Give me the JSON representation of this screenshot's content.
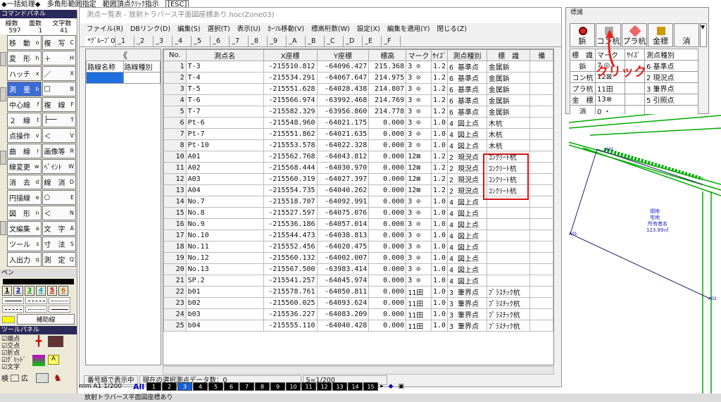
{
  "topbar": {
    "items": [
      "◆一括処理◆",
      "多角形範囲指定",
      "範囲頂点ｸﾘｯｸ指示",
      "[ESC]"
    ]
  },
  "left_panel": {
    "title": "コマンドパネル",
    "counts": {
      "labels": [
        "線数",
        "面数",
        "文字数"
      ],
      "values": [
        "597",
        "1",
        "41"
      ]
    },
    "commands": [
      [
        "移　動",
        "o",
        "複　写",
        "C"
      ],
      [
        "変　形",
        "h",
        "＋",
        "H"
      ],
      [
        "ハッチ",
        "x",
        "／",
        "X"
      ],
      [
        "測　量",
        "b",
        "□",
        "B"
      ],
      [
        "中心線",
        "f",
        "複　線",
        "F"
      ],
      [
        "２　線",
        "t",
        "├──",
        "T"
      ],
      [
        "点操作",
        "v",
        "＜",
        "V"
      ],
      [
        "曲　線",
        "r",
        "画像等",
        "R"
      ],
      [
        "線変更",
        "w",
        "ﾍﾟｲﾝﾄ",
        "W"
      ],
      [
        "消　去",
        "d",
        "線　消",
        "D"
      ],
      [
        "円描線",
        "e",
        "○",
        "E"
      ],
      [
        "図　形",
        "n",
        "＜",
        "N"
      ],
      [
        "文編集",
        "a",
        "文　字",
        "A"
      ],
      [
        "ツール",
        "s",
        "寸　法",
        "S"
      ],
      [
        "入出力",
        "q",
        "測　定",
        "Q"
      ]
    ],
    "pen_title": "ペン",
    "pens": [
      "1",
      "2",
      "3",
      "4",
      "5",
      "6"
    ],
    "helper_label": "補助線",
    "tool_title": "ツールパネル",
    "tool_checks": [
      "端点",
      "交点",
      "折点",
      "ｸﾞﾘｯﾄﾞ",
      "文字"
    ],
    "bottom": {
      "a": "検",
      "b": "広"
    }
  },
  "window": {
    "title": "測点一覧表 - 放射トラバース平面図座標あり.hoc(Zone03)",
    "menu": [
      "ファイル(R)",
      "DBリンク(D)",
      "編集(S)",
      "選択(T)",
      "表示(U)",
      "ｶｰｿﾙ移動(V)",
      "標高桁数(W)",
      "設定(X)",
      "編集を適用(Y)",
      "閉じる(Z)"
    ],
    "groups": [
      "*ｸﾞﾙｰﾌﾟ0",
      "_1",
      "_2",
      "_3",
      "_4",
      "_5",
      "_6",
      "_7",
      "_8",
      "_9",
      "_A",
      "_B",
      "_C",
      "_D",
      "_E",
      "_F"
    ],
    "left_pane": {
      "arrow": "《",
      "col1": "路線名称",
      "col2": "路線種別"
    },
    "columns": [
      "No.",
      "測点名",
      "X座標",
      "Y座標",
      "標高",
      "マーク",
      "ｻｲｽﾞ",
      "測点種別",
      "標　識",
      "備"
    ],
    "rows": [
      [
        "1",
        "T-3",
        "-215510.812",
        "-64096.427",
        "215.368",
        "3 ⊙",
        "1.2",
        "6 基準点",
        "金属鋲"
      ],
      [
        "2",
        "T-4",
        "-215534.291",
        "-64067.647",
        "214.975",
        "3 ⊙",
        "1.2",
        "6 基準点",
        "金属鋲"
      ],
      [
        "3",
        "T-5",
        "-215551.628",
        "-64028.438",
        "214.807",
        "3 ⊙",
        "1.2",
        "6 基準点",
        "金属鋲"
      ],
      [
        "4",
        "T-6",
        "-215566.974",
        "-63992.468",
        "214.769",
        "3 ⊙",
        "1.2",
        "6 基準点",
        "金属鋲"
      ],
      [
        "5",
        "T-7",
        "-215582.329",
        "-63956.860",
        "214.778",
        "3 ⊙",
        "1.2",
        "6 基準点",
        "金属鋲"
      ],
      [
        "6",
        "Pt-6",
        "-215548.960",
        "-64021.175",
        "0.000",
        "3 ⊙",
        "1.0",
        "4 図上点",
        "木杭"
      ],
      [
        "7",
        "Pt-7",
        "-215551.862",
        "-64021.635",
        "0.000",
        "3 ⊙",
        "1.0",
        "4 図上点",
        "木杭"
      ],
      [
        "8",
        "Pt-10",
        "-215553.578",
        "-64022.328",
        "0.000",
        "3 ⊙",
        "1.0",
        "4 図上点",
        "木杭"
      ],
      [
        "10",
        "A01",
        "-215562.768",
        "-64043.812",
        "0.000",
        "12⊠",
        "1.2",
        "2 現況点",
        "ｺﾝｸﾘｰﾄ杭"
      ],
      [
        "11",
        "A02",
        "-215568.444",
        "-64030.970",
        "0.000",
        "12⊠",
        "1.2",
        "2 現況点",
        "ｺﾝｸﾘｰﾄ杭"
      ],
      [
        "12",
        "A03",
        "-215560.319",
        "-64027.397",
        "0.000",
        "12⊠",
        "1.2",
        "2 現況点",
        "ｺﾝｸﾘｰﾄ杭"
      ],
      [
        "13",
        "A04",
        "-215554.735",
        "-64040.262",
        "0.000",
        "12⊠",
        "1.2",
        "2 現況点",
        "ｺﾝｸﾘｰﾄ杭"
      ],
      [
        "14",
        "No.7",
        "-215518.707",
        "-64092.991",
        "0.000",
        "3 ⊙",
        "1.0",
        "4 図上点",
        ""
      ],
      [
        "15",
        "No.8",
        "-215527.597",
        "-64075.076",
        "0.000",
        "3 ⊙",
        "1.0",
        "4 図上点",
        ""
      ],
      [
        "16",
        "No.9",
        "-215536.186",
        "-64057.014",
        "0.000",
        "3 ⊙",
        "1.0",
        "4 図上点",
        ""
      ],
      [
        "17",
        "No.10",
        "-215544.473",
        "-64038.813",
        "0.000",
        "3 ⊙",
        "1.0",
        "4 図上点",
        ""
      ],
      [
        "18",
        "No.11",
        "-215552.456",
        "-64020.475",
        "0.000",
        "3 ⊙",
        "1.0",
        "4 図上点",
        ""
      ],
      [
        "19",
        "No.12",
        "-215560.132",
        "-64002.007",
        "0.000",
        "3 ⊙",
        "1.0",
        "4 図上点",
        ""
      ],
      [
        "20",
        "No.13",
        "-215567.500",
        "-63983.414",
        "0.000",
        "3 ⊙",
        "1.0",
        "4 図上点",
        ""
      ],
      [
        "21",
        "SP.2",
        "-215541.257",
        "-64045.974",
        "0.000",
        "3 ⊙",
        "1.0",
        "4 図上点",
        ""
      ],
      [
        "22",
        "b01",
        "-215578.761",
        "-64050.811",
        "0.000",
        "11田",
        "1.0",
        "3 筆界点",
        "ﾌﾟﾗｽﾁｯｸ杭"
      ],
      [
        "23",
        "b02",
        "-215560.025",
        "-64093.624",
        "0.000",
        "11田",
        "1.0",
        "3 筆界点",
        "ﾌﾟﾗｽﾁｯｸ杭"
      ],
      [
        "24",
        "b03",
        "-215536.227",
        "-64083.209",
        "0.000",
        "11田",
        "1.0",
        "3 筆界点",
        "ﾌﾟﾗｽﾁｯｸ杭"
      ],
      [
        "25",
        "b04",
        "-215555.110",
        "-64040.428",
        "0.000",
        "11田",
        "1.0",
        "3 筆界点",
        "ﾌﾟﾗｽﾁｯｸ杭"
      ]
    ],
    "status": [
      "番号順で表示中",
      "現在の選択測点データ数：0",
      "S=1/200"
    ]
  },
  "bottom_bar": {
    "scale_text": "mm  A1   1/200",
    "all": "All",
    "pages": [
      "1",
      "2",
      "3",
      "4",
      "5",
      "6",
      "7",
      "8",
      "9",
      "10",
      "11",
      "12",
      "13",
      "14",
      "15"
    ],
    "selected": "3"
  },
  "taskbar": {
    "label": "放射トラバース平面図座標あり"
  },
  "right_panel": {
    "title": "標識",
    "buttons": [
      "鋲",
      "コン杭",
      "プラ杭",
      "金標",
      "消"
    ],
    "table_head": [
      "標　識",
      "マーク",
      "ｻｲｽﾞ",
      "測点種別"
    ],
    "rows": [
      [
        "鋲",
        "7 ◎",
        "",
        "6 基準点"
      ],
      [
        "コン杭",
        "12⊠",
        "",
        "2 現況点"
      ],
      [
        "プラ杭",
        "11田",
        "",
        "3 筆界点"
      ],
      [
        "金　標",
        "13⊗",
        "",
        "5 引照点"
      ],
      [
        "消",
        "0 ・",
        "",
        ""
      ]
    ],
    "annotation": "クリック"
  },
  "drawing": {
    "label1": "畑地",
    "label2": "宅地",
    "label3": "所有者名",
    "label4": "123.89㎡",
    "pt1": "A01",
    "pt2": "A02",
    "pt3": "A01"
  }
}
